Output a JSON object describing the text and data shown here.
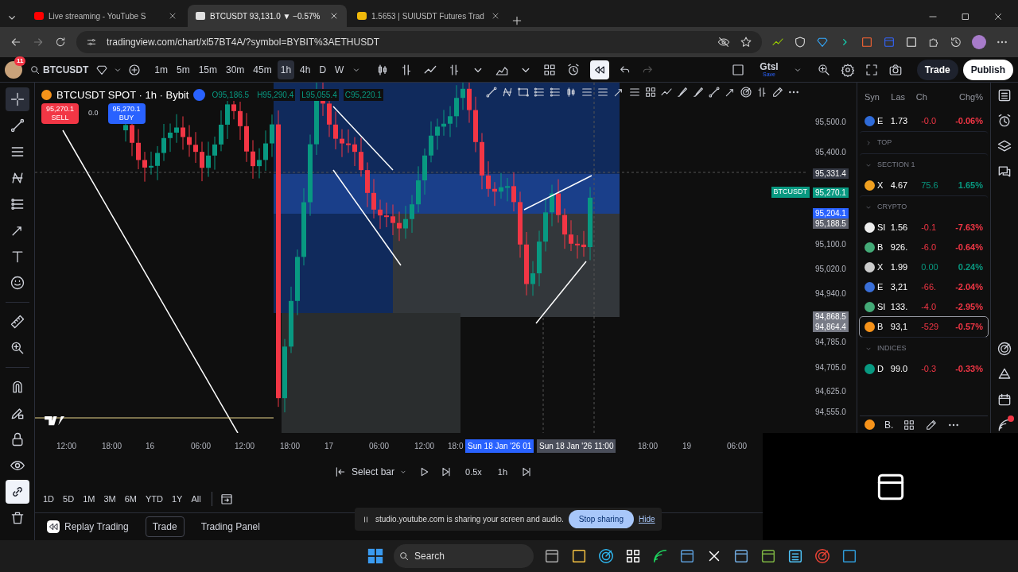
{
  "browser": {
    "tabs": [
      {
        "title": "Live streaming - YouTube S",
        "selected": false
      },
      {
        "title": "BTCUSDT 93,131.0 ▼ −0.57%",
        "selected": true
      },
      {
        "title": "1.5653 | SUIUSDT Futures Trad",
        "selected": false
      }
    ],
    "url": "tradingview.com/chart/xl57BT4A/?symbol=BYBIT%3AETHUSDT"
  },
  "toolbar": {
    "notification_count": "11",
    "symbol": "BTCUSDT",
    "intervals": [
      {
        "label": "1m",
        "selected": false
      },
      {
        "label": "5m",
        "selected": false
      },
      {
        "label": "15m",
        "selected": false
      },
      {
        "label": "30m",
        "selected": false
      },
      {
        "label": "45m",
        "selected": false
      },
      {
        "label": "1h",
        "selected": true
      },
      {
        "label": "4h",
        "selected": false
      },
      {
        "label": "D",
        "selected": false
      },
      {
        "label": "W",
        "selected": false
      }
    ],
    "layout_name": "Gtsl",
    "layout_status": "Save",
    "trade_button": "Trade",
    "publish_button": "Publish"
  },
  "left_tools": [
    {
      "kind": "crosshair",
      "selected": true,
      "on": false
    },
    {
      "kind": "trend",
      "selected": false,
      "on": false
    },
    {
      "kind": "hlines",
      "selected": false,
      "on": false
    },
    {
      "kind": "pattern",
      "selected": false,
      "on": false
    },
    {
      "kind": "fork",
      "selected": false,
      "on": false
    },
    {
      "kind": "arrowline",
      "selected": false,
      "on": false
    },
    {
      "kind": "text",
      "selected": false,
      "on": false
    },
    {
      "kind": "smile",
      "selected": false,
      "on": false
    },
    {
      "kind": "ruler",
      "selected": false,
      "on": false
    },
    {
      "kind": "zoom",
      "selected": false,
      "on": false
    },
    {
      "kind": "magnet",
      "selected": false,
      "on": false
    },
    {
      "kind": "pencil",
      "selected": false,
      "on": false
    },
    {
      "kind": "lock",
      "selected": false,
      "on": false
    },
    {
      "kind": "eye",
      "selected": false,
      "on": false
    },
    {
      "kind": "link",
      "selected": false,
      "on": true
    },
    {
      "kind": "trash",
      "selected": false,
      "on": false
    }
  ],
  "chart": {
    "legend": {
      "title": "BTCUSDT SPOT · 1h · Bybit",
      "ohlc": [
        "O95,186.5",
        "H95,290.4",
        "L95,055.4",
        "C95,220.1"
      ]
    },
    "sell": {
      "price": "95,270.1",
      "label": "SELL"
    },
    "spread": "0.0",
    "buy": {
      "price": "95,270.1",
      "label": "BUY"
    },
    "symbol_tag": "BTCUSDT"
  },
  "price_axis": [
    {
      "kind": "tick",
      "text": "95,500.0"
    },
    {
      "kind": "tick",
      "text": "95,400.0"
    },
    {
      "kind": "tag",
      "text": "95,331.4",
      "color": "#363a45"
    },
    {
      "kind": "tag",
      "text": "95,270.1",
      "color": "#089981"
    },
    {
      "kind": "tag",
      "text": "95,204.1",
      "color": "#2962ff"
    },
    {
      "kind": "tag",
      "text": "95,188.5",
      "color": "#5d606b"
    },
    {
      "kind": "tick",
      "text": "95,100.0"
    },
    {
      "kind": "tick",
      "text": "95,020.0"
    },
    {
      "kind": "tick",
      "text": "94,940.0"
    },
    {
      "kind": "tag",
      "text": "94,868.5",
      "color": "#787b86"
    },
    {
      "kind": "tag",
      "text": "94,864.4",
      "color": "#787b86"
    },
    {
      "kind": "tick",
      "text": "94,785.0"
    },
    {
      "kind": "tick",
      "text": "94,705.0"
    },
    {
      "kind": "tick",
      "text": "94,625.0"
    },
    {
      "kind": "tick",
      "text": "94,555.0"
    }
  ],
  "time_axis": [
    {
      "kind": "tick",
      "text": "12:00"
    },
    {
      "kind": "tick",
      "text": "18:00"
    },
    {
      "kind": "tick",
      "text": "16"
    },
    {
      "kind": "tick",
      "text": "06:00"
    },
    {
      "kind": "tick",
      "text": "12:00"
    },
    {
      "kind": "tick",
      "text": "18:00"
    },
    {
      "kind": "tick",
      "text": "17"
    },
    {
      "kind": "tick",
      "text": "06:00"
    },
    {
      "kind": "tick",
      "text": "12:00"
    },
    {
      "kind": "tick",
      "text": "18:0"
    },
    {
      "kind": "tag",
      "text": "Sun 18 Jan '26  01",
      "color": "#2962ff"
    },
    {
      "kind": "tag",
      "text": "Sun 18 Jan '26   11:00",
      "color": "#4a4e5a"
    },
    {
      "kind": "tick",
      "text": "18:00"
    },
    {
      "kind": "tick",
      "text": "19"
    },
    {
      "kind": "tick",
      "text": "06:00"
    }
  ],
  "watchlist": {
    "columns": [
      "Syn",
      "Las",
      "Ch",
      "Chg%"
    ],
    "items": [
      {
        "kind": "row",
        "symbol": "E",
        "last": "1.73",
        "change": "-0.0",
        "change_pct": "-0.06%",
        "color": "#f23645",
        "selected": false
      },
      {
        "kind": "section",
        "label": "TOP",
        "expanded": false
      },
      {
        "kind": "section",
        "label": "SECTION 1",
        "expanded": true
      },
      {
        "kind": "row",
        "symbol": "X",
        "last": "4.67",
        "change": "75.6",
        "change_pct": "1.65%",
        "color": "#089981",
        "selected": false
      },
      {
        "kind": "section",
        "label": "CRYPTO",
        "expanded": true
      },
      {
        "kind": "row",
        "symbol": "SI",
        "last": "1.56",
        "change": "-0.1",
        "change_pct": "-7.63%",
        "color": "#f23645",
        "selected": false
      },
      {
        "kind": "row",
        "symbol": "B",
        "last": "926.",
        "change": "-6.0",
        "change_pct": "-0.64%",
        "color": "#f23645",
        "selected": false
      },
      {
        "kind": "row",
        "symbol": "X",
        "last": "1.99",
        "change": "0.00",
        "change_pct": "0.24%",
        "color": "#089981",
        "selected": false
      },
      {
        "kind": "row",
        "symbol": "E",
        "last": "3,21",
        "change": "-66.",
        "change_pct": "-2.04%",
        "color": "#f23645",
        "selected": false
      },
      {
        "kind": "row",
        "symbol": "SI",
        "last": "133.",
        "change": "-4.0",
        "change_pct": "-2.95%",
        "color": "#f23645",
        "selected": false
      },
      {
        "kind": "row",
        "symbol": "B",
        "last": "93,1",
        "change": "-529",
        "change_pct": "-0.57%",
        "color": "#f23645",
        "selected": true
      },
      {
        "kind": "section",
        "label": "INDICES",
        "expanded": true
      },
      {
        "kind": "row",
        "symbol": "D",
        "last": "99.0",
        "change": "-0.3",
        "change_pct": "-0.33%",
        "color": "#f23645",
        "selected": false
      }
    ],
    "footer_symbol": "B."
  },
  "replay": {
    "select_bar": "Select bar",
    "speed": "0.5x",
    "interval": "1h"
  },
  "ranges": [
    "1D",
    "5D",
    "1M",
    "3M",
    "6M",
    "YTD",
    "1Y",
    "All"
  ],
  "bottom_tabs": [
    {
      "label": "Replay Trading",
      "selected": false
    },
    {
      "label": "Trade",
      "selected": true
    },
    {
      "label": "Trading Panel",
      "selected": false
    }
  ],
  "share_bar": {
    "message": "studio.youtube.com is sharing your screen and audio.",
    "stop": "Stop sharing",
    "hide": "Hide"
  },
  "taskbar": {
    "search": "Search"
  }
}
